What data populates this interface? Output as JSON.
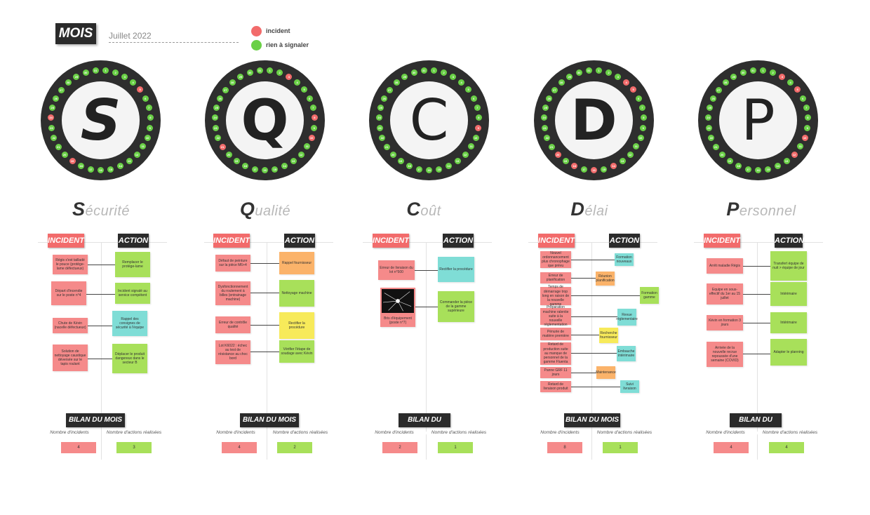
{
  "header": {
    "mois_label": "MOIS",
    "month": "Juillet 2022",
    "legend": [
      {
        "label": "incident",
        "color": "#f26b6b"
      },
      {
        "label": "rien à signaler",
        "color": "#6ad046"
      }
    ]
  },
  "pillars": [
    {
      "letter": "S",
      "title_first": "S",
      "title_rest": "écurité",
      "incident_label": "INCIDENT",
      "action_label": "ACTION",
      "incidents": [
        "Régis s'est tailladé le pouce (protège-lame défectueux)",
        "Départ d'incendie sur le poste n°4",
        "Chute de Kévin (nacelle défectueux)",
        "Solution de nettoyage caustique déversée sur le tapis roulant"
      ],
      "actions": [
        "Remplacer le protège-lame",
        "Incident signalé au service compétent",
        "Rappel des consignes de sécurité à l'équipe",
        "Déplacer le produit dangereux dans le secteur B"
      ],
      "bilan_label": "BILAN DU MOIS",
      "nb_incidents_label": "Nombre d'incidents",
      "nb_actions_label": "Nombre d'actions réalisées",
      "nb_incidents": "4",
      "nb_actions": "3"
    },
    {
      "letter": "Q",
      "title_first": "Q",
      "title_rest": "ualité",
      "incident_label": "INCIDENT",
      "action_label": "ACTION",
      "incidents": [
        "Défaut de peinture sur la pièce M6+4",
        "Dysfonctionnement du roulement à billes (entrainage machine)",
        "Erreur de contrôle qualité",
        "Lot K6022 : échec au test de résistance au choc bord"
      ],
      "actions": [
        "Rappel fournisseur",
        "Nettoyage machine",
        "Rectifier la procédure",
        "Vérifier l'étape de soudage avec Kévin"
      ],
      "bilan_label": "BILAN DU MOIS",
      "nb_incidents_label": "Nombre d'incidents",
      "nb_actions_label": "Nombre d'actions réalisées",
      "nb_incidents": "4",
      "nb_actions": "2"
    },
    {
      "letter": "C",
      "title_first": "C",
      "title_rest": "oût",
      "incident_label": "INCIDENT",
      "action_label": "ACTION",
      "incidents": [
        "Erreur de livraison du lot n°500",
        "Bris d'équipement (poste n°7)"
      ],
      "actions": [
        "Rectifier la procédure",
        "Commander la pièce de la gamme supérieure"
      ],
      "bilan_label": "BILAN DU MOIS",
      "nb_incidents_label": "Nombre d'incidents",
      "nb_actions_label": "Nombre d'actions réalisées",
      "nb_incidents": "2",
      "nb_actions": "1"
    },
    {
      "letter": "D",
      "title_first": "D",
      "title_rest": "élai",
      "incident_label": "INCIDENT",
      "action_label": "ACTION",
      "incidents": [
        "Nouvel ordonnancement plus chronophage que prévu",
        "Erreur de planification",
        "Temps de démarrage trop long en raison de la nouvelle gamme",
        "Préparation machine ralentie suite à la nouvelle réglementation",
        "Pénurie de matière première",
        "Retard de production suite au manque de personnel de la gamme Fluenta",
        "Panne GRF 11 jours",
        "Retard de livraison produit"
      ],
      "actions": [
        "Formation nouveaux",
        "Réunion planification",
        "Formation gamme",
        "Revue réglementaire",
        "Recherche fournisseur",
        "Embauche intérimaire",
        "Maintenance",
        "Suivi livraison"
      ],
      "bilan_label": "BILAN DU MOIS",
      "nb_incidents_label": "Nombre d'incidents",
      "nb_actions_label": "Nombre d'actions réalisées",
      "nb_incidents": "8",
      "nb_actions": "1"
    },
    {
      "letter": "P",
      "title_first": "P",
      "title_rest": "ersonnel",
      "incident_label": "INCIDENT",
      "action_label": "ACTION",
      "incidents": [
        "Arrêt maladie Régis",
        "Equipe en sous-effectif du 1er au 15 juillet",
        "Kévin en formation 3 jours",
        "Arrivée de la nouvelle recrue repoussée d'une semaine (COVID)"
      ],
      "actions": [
        "Transfert équipe de nuit > équipe de jour",
        "Intérimaire",
        "Intérimaire",
        "Adapter le planning"
      ],
      "bilan_label": "BILAN DU MOIS",
      "nb_incidents_label": "Nombre d'incidents",
      "nb_actions_label": "Nombre d'actions réalisées",
      "nb_incidents": "4",
      "nb_actions": "4"
    }
  ],
  "colors": {
    "incident": "#f26b6b",
    "ok": "#6ad046",
    "dark": "#2b2b2b"
  }
}
